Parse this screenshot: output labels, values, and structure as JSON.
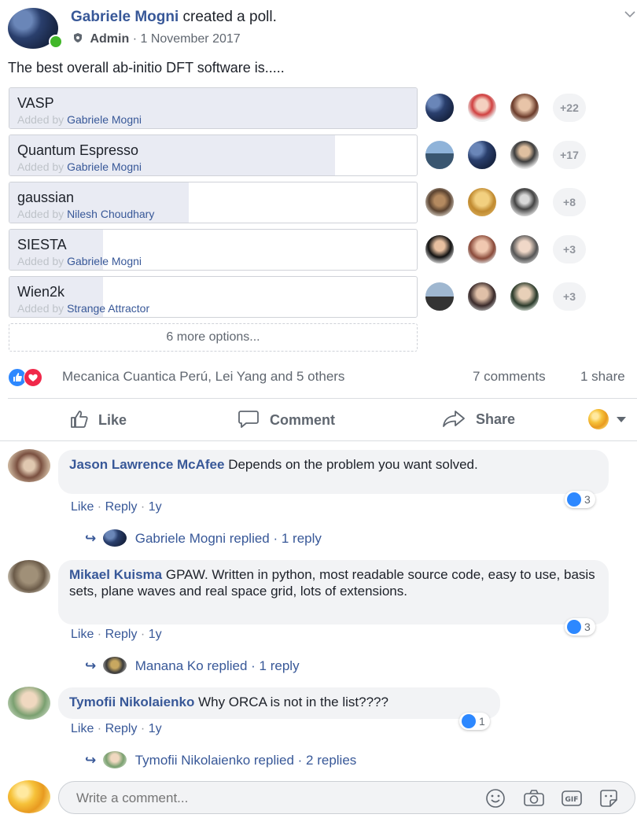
{
  "post": {
    "author": "Gabriele Mogni",
    "action": "created a poll.",
    "role": "Admin",
    "date": "1 November 2017",
    "question": "The best overall ab-initio DFT software is....."
  },
  "poll": {
    "added_by_prefix": "Added by",
    "options": [
      {
        "name": "VASP",
        "added_by": "Gabriele Mogni",
        "fill": 1.0,
        "more": "+22"
      },
      {
        "name": "Quantum Espresso",
        "added_by": "Gabriele Mogni",
        "fill": 0.8,
        "more": "+17"
      },
      {
        "name": "gaussian",
        "added_by": "Nilesh Choudhary",
        "fill": 0.44,
        "more": "+8"
      },
      {
        "name": "SIESTA",
        "added_by": "Gabriele Mogni",
        "fill": 0.23,
        "more": "+3"
      },
      {
        "name": "Wien2k",
        "added_by": "Strange Attractor",
        "fill": 0.23,
        "more": "+3"
      }
    ],
    "more_options": "6 more options..."
  },
  "reactions": {
    "summary": "Mecanica Cuantica Perú, Lei Yang and 5 others",
    "comments": "7 comments",
    "shares": "1 share"
  },
  "actions": {
    "like": "Like",
    "comment": "Comment",
    "share": "Share"
  },
  "comments": [
    {
      "author": "Jason Lawrence McAfee",
      "text": "Depends on the problem you want solved.",
      "like": "Like",
      "reply": "Reply",
      "time": "1y",
      "reactions": "3",
      "replied_by": "Gabriele Mogni replied",
      "reply_count": "1 reply"
    },
    {
      "author": "Mikael Kuisma",
      "text": "GPAW. Written in python, most readable source code, easy to use, basis sets, plane waves and real space grid, lots of extensions.",
      "like": "Like",
      "reply": "Reply",
      "time": "1y",
      "reactions": "3",
      "replied_by": "Manana Ko replied",
      "reply_count": "1 reply"
    },
    {
      "author": "Tymofii Nikolaienko",
      "text": "Why ORCA is not in the list????",
      "like": "Like",
      "reply": "Reply",
      "time": "1y",
      "reactions": "1",
      "replied_by": "Tymofii Nikolaienko replied",
      "reply_count": "2 replies"
    }
  ],
  "composer": {
    "placeholder": "Write a comment..."
  },
  "icons": [
    "shield-icon",
    "thumbs-up-icon",
    "comment-icon",
    "share-icon",
    "reaction-selector-icon",
    "emoji-icon",
    "camera-icon",
    "gif-icon",
    "sticker-icon",
    "reply-arrow-icon",
    "chevron-down-icon"
  ],
  "colors": {
    "link": "#385898",
    "like_blue": "#2d88ff",
    "love_red": "#f0284a",
    "online_green": "#42b72a"
  }
}
